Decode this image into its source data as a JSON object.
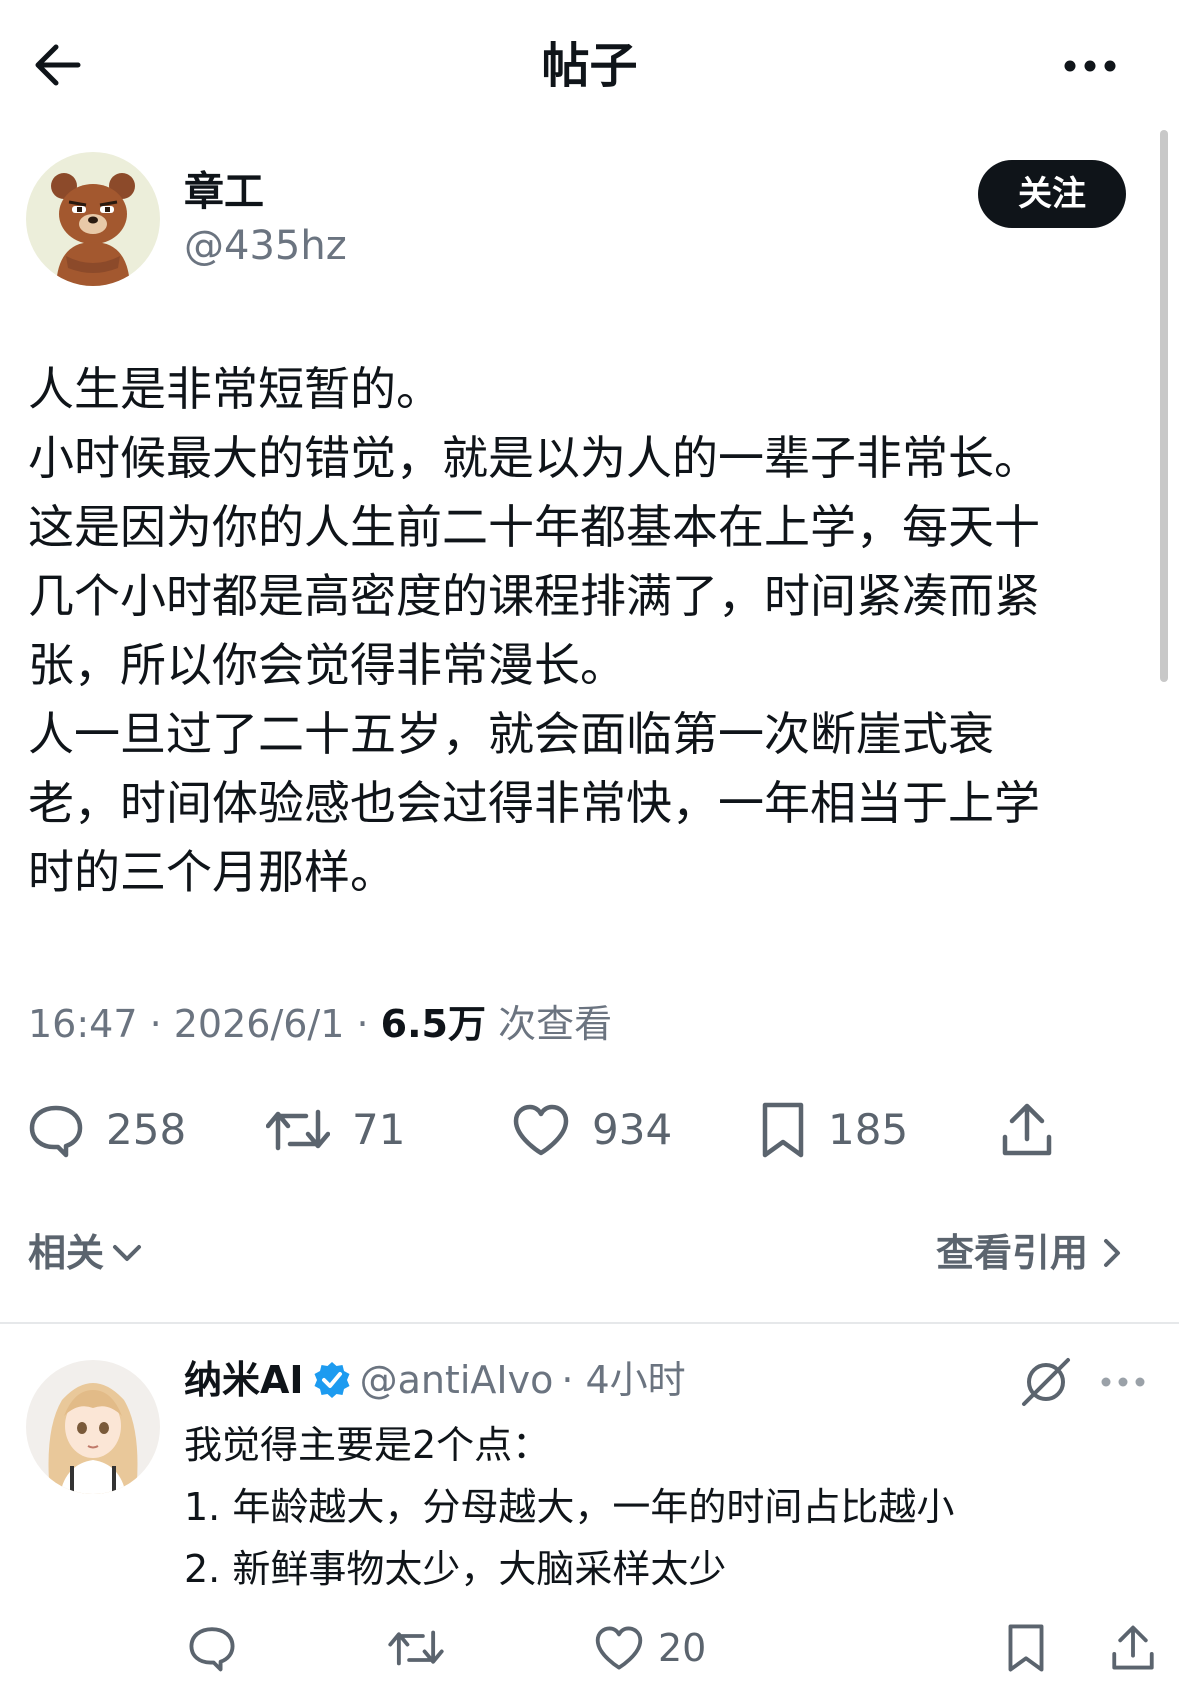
{
  "header": {
    "title": "帖子",
    "back_icon": "arrow-left-icon",
    "more_icon": "ellipsis-icon"
  },
  "author": {
    "name": "章工",
    "handle": "@435hz",
    "follow_label": "关注",
    "avatar": "bear-avatar"
  },
  "tweet": {
    "lines": [
      "人生是非常短暂的。",
      "小时候最大的错觉，就是以为人的一辈子非常长。",
      "这是因为你的人生前二十年都基本在上学，每天十",
      "几个小时都是高密度的课程排满了，时间紧凑而紧",
      "张，所以你会觉得非常漫长。",
      "人一旦过了二十五岁，就会面临第一次断崖式衰",
      "老，时间体验感也会过得非常快，一年相当于上学",
      "时的三个月那样。"
    ],
    "time": "16:47 · 2026/6/1 · ",
    "views_count": "6.5万",
    "views_label": " 次查看"
  },
  "actions": {
    "replies": "258",
    "retweets": "71",
    "likes": "934",
    "bookmarks": "185"
  },
  "related": {
    "label": "相关",
    "quotes_label": "查看引用"
  },
  "reply": {
    "name": "纳米AI",
    "handle": "@antiAIvo",
    "time": "· 4小时",
    "lines": [
      "我觉得主要是2个点：",
      "1. 年龄越大，分母越大，一年的时间占比越小",
      "2. 新鲜事物太少，大脑采样太少"
    ],
    "likes": "20",
    "verified_color": "#1d9bf0"
  },
  "colors": {
    "text": "#0f1419",
    "secondary": "#6b7480",
    "follow_bg": "#0f1419"
  }
}
